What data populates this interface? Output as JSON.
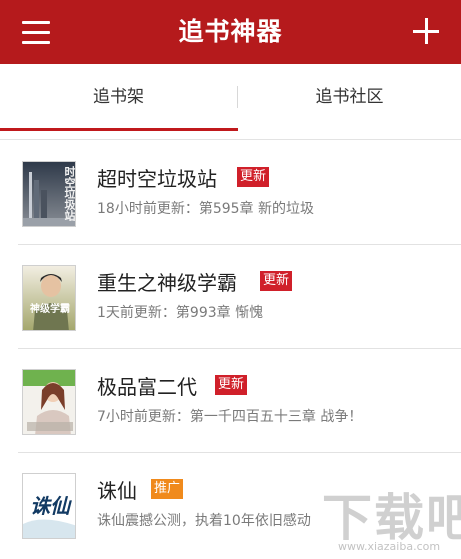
{
  "app_bar": {
    "title": "追书神器",
    "menu_icon": "hamburger-menu-icon",
    "add_icon": "plus-icon",
    "color": "#b51a1c"
  },
  "tabs": [
    {
      "label": "追书架",
      "active": true
    },
    {
      "label": "追书社区",
      "active": false
    }
  ],
  "books": [
    {
      "title": "超时空垃圾站",
      "badge": "更新",
      "badge_type": "update",
      "subtitle": "18小时前更新：第595章 新的垃圾",
      "cover_text": "时空垃圾站"
    },
    {
      "title": "重生之神级学霸",
      "badge": "更新",
      "badge_type": "update",
      "subtitle": "1天前更新：第993章 惭愧",
      "cover_text": "神级学霸"
    },
    {
      "title": "极品富二代",
      "badge": "更新",
      "badge_type": "update",
      "subtitle": "7小时前更新：第一千四百五十三章 战争！",
      "cover_text": ""
    },
    {
      "title": "诛仙",
      "badge": "推广",
      "badge_type": "promo",
      "subtitle": "诛仙震撼公测，执着10年依旧感动",
      "cover_text": "诛仙"
    }
  ],
  "colors": {
    "accent": "#c0191c",
    "update_badge": "#d0202a",
    "promo_badge": "#f08a1c"
  },
  "watermark": {
    "text": "下载吧",
    "url": "www.xiazaiba.com"
  }
}
